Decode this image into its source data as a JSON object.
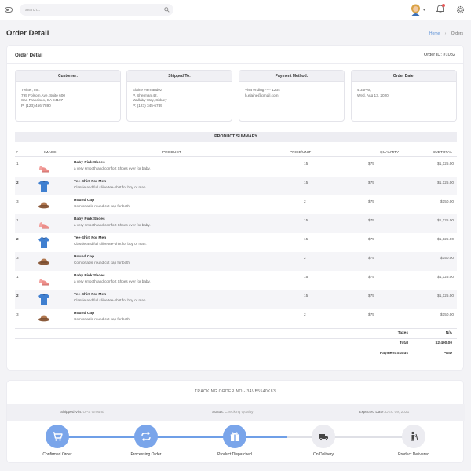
{
  "topbar": {
    "search_placeholder": "search...",
    "notification_count": ""
  },
  "page": {
    "title": "Order Detail",
    "breadcrumb": {
      "home": "Home",
      "current": "Orders"
    }
  },
  "order": {
    "title": "Order Detail",
    "order_id": "Order ID: #1082",
    "customer": {
      "heading": "Customer:",
      "lines": [
        "Twitter, Inc.",
        "795 Folsom Ave, Suite 600",
        "San Francisco, CA 94107",
        "P: (123) 456-7890"
      ]
    },
    "shipped_to": {
      "heading": "Shipped To:",
      "lines": [
        "Elaine Hernandez",
        "P. Sherman 42,",
        "Wallaby Way, Sidney",
        "P: (123) 345-6789"
      ]
    },
    "payment": {
      "heading": "Payment Method:",
      "lines": [
        "Visa ending **** 1234",
        "h.elaine@gmail.com"
      ]
    },
    "date": {
      "heading": "Order Date:",
      "lines": [
        "4:34PM,",
        "Wed, Aug 13, 2020"
      ]
    }
  },
  "summary": {
    "title": "PRODUCT SUMMARY",
    "headers": {
      "num": "#",
      "image": "IMAGE",
      "product": "PRODUCT",
      "price": "PRICE/UNIT",
      "quantity": "QUANTITY",
      "subtotal": "SUBTOTAL"
    },
    "rows": [
      {
        "num": "1",
        "image": "pink-shoes",
        "name": "Baby Pink Shoes",
        "desc": "a very smooth and comfort Shoes ever for baby.",
        "qty": "15",
        "price": "$75",
        "subtotal": "$1,125.00"
      },
      {
        "num": "2",
        "image": "blue-tshirt",
        "name": "Tee-Shirt For Men",
        "desc": "Classie and full sliive tee-shirt for boy or man.",
        "qty": "15",
        "price": "$75",
        "subtotal": "$1,125.00"
      },
      {
        "num": "3",
        "image": "round-cap",
        "name": "Round Cap",
        "desc": "Comfortable round cut cap for both.",
        "qty": "2",
        "price": "$75",
        "subtotal": "$150.00"
      },
      {
        "num": "1",
        "image": "pink-shoes",
        "name": "Baby Pink Shoes",
        "desc": "a very smooth and comfort Shoes ever for baby.",
        "qty": "15",
        "price": "$75",
        "subtotal": "$1,125.00"
      },
      {
        "num": "2",
        "image": "blue-tshirt",
        "name": "Tee-Shirt For Men",
        "desc": "Classie and full sliive tee-shirt for boy or man.",
        "qty": "15",
        "price": "$75",
        "subtotal": "$1,125.00"
      },
      {
        "num": "3",
        "image": "round-cap",
        "name": "Round Cap",
        "desc": "Comfortable round cut cap for both.",
        "qty": "2",
        "price": "$75",
        "subtotal": "$150.00"
      },
      {
        "num": "1",
        "image": "pink-shoes",
        "name": "Baby Pink Shoes",
        "desc": "a very smooth and comfort Shoes ever for baby.",
        "qty": "15",
        "price": "$75",
        "subtotal": "$1,125.00"
      },
      {
        "num": "2",
        "image": "blue-tshirt",
        "name": "Tee-Shirt For Men",
        "desc": "Classie and full sliive tee-shirt for boy or man.",
        "qty": "15",
        "price": "$75",
        "subtotal": "$1,125.00"
      },
      {
        "num": "3",
        "image": "round-cap",
        "name": "Round Cap",
        "desc": "Comfortable round cut cap for both.",
        "qty": "2",
        "price": "$75",
        "subtotal": "$150.00"
      }
    ],
    "totals": {
      "taxes_label": "Taxes",
      "taxes_value": "N/A",
      "total_label": "Total",
      "total_value": "$2,400.00",
      "status_label": "Payment Status",
      "status_value": "PAID"
    }
  },
  "tracking": {
    "header": "TRACKING ORDER NO - 34VB5540K83",
    "shipped_via_label": "Shipped Via:",
    "shipped_via_value": "UPS Ground",
    "status_label": "Status:",
    "status_value": "Checking Quality",
    "expected_label": "Expected Date:",
    "expected_value": "DEC 09, 2021",
    "steps": [
      {
        "label": "Confirmed Order",
        "icon": "cart-icon",
        "done": true
      },
      {
        "label": "Processing Order",
        "icon": "refresh-icon",
        "done": true
      },
      {
        "label": "Product Dispatched",
        "icon": "gift-icon",
        "done": true
      },
      {
        "label": "On Delivery",
        "icon": "truck-icon",
        "done": false
      },
      {
        "label": "Product Delivered",
        "icon": "person-icon",
        "done": false
      }
    ]
  },
  "colors": {
    "accent": "#5a8fd6",
    "step_done": "#7aa5ea",
    "alert": "#e85a5a"
  }
}
